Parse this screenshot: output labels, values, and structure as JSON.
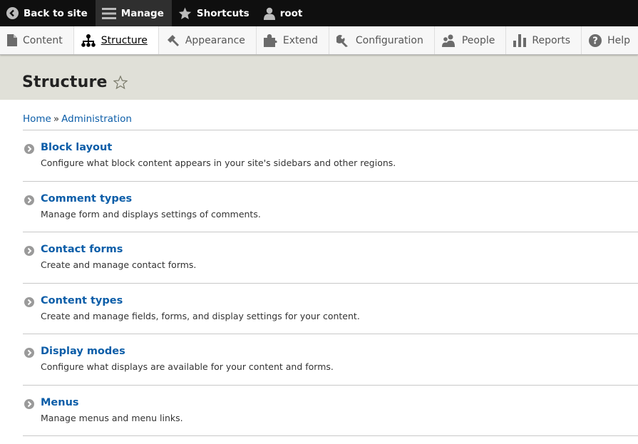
{
  "toolbar": {
    "back": "Back to site",
    "manage": "Manage",
    "shortcuts": "Shortcuts",
    "user": "root"
  },
  "tray": {
    "items": [
      "Content",
      "Structure",
      "Appearance",
      "Extend",
      "Configuration",
      "People",
      "Reports",
      "Help"
    ],
    "active": "Structure"
  },
  "page": {
    "title": "Structure"
  },
  "breadcrumb": {
    "home": "Home",
    "separator": "»",
    "administration": "Administration"
  },
  "items": [
    {
      "label": "Block layout",
      "desc": "Configure what block content appears in your site's sidebars and other regions."
    },
    {
      "label": "Comment types",
      "desc": "Manage form and displays settings of comments."
    },
    {
      "label": "Contact forms",
      "desc": "Create and manage contact forms."
    },
    {
      "label": "Content types",
      "desc": "Create and manage fields, forms, and display settings for your content."
    },
    {
      "label": "Display modes",
      "desc": "Configure what displays are available for your content and forms."
    },
    {
      "label": "Menus",
      "desc": "Manage menus and menu links."
    }
  ],
  "colors": {
    "link": "#0b5da8",
    "toolbar_bg": "#0f0f0f",
    "header_bg": "#e0e0d8"
  }
}
